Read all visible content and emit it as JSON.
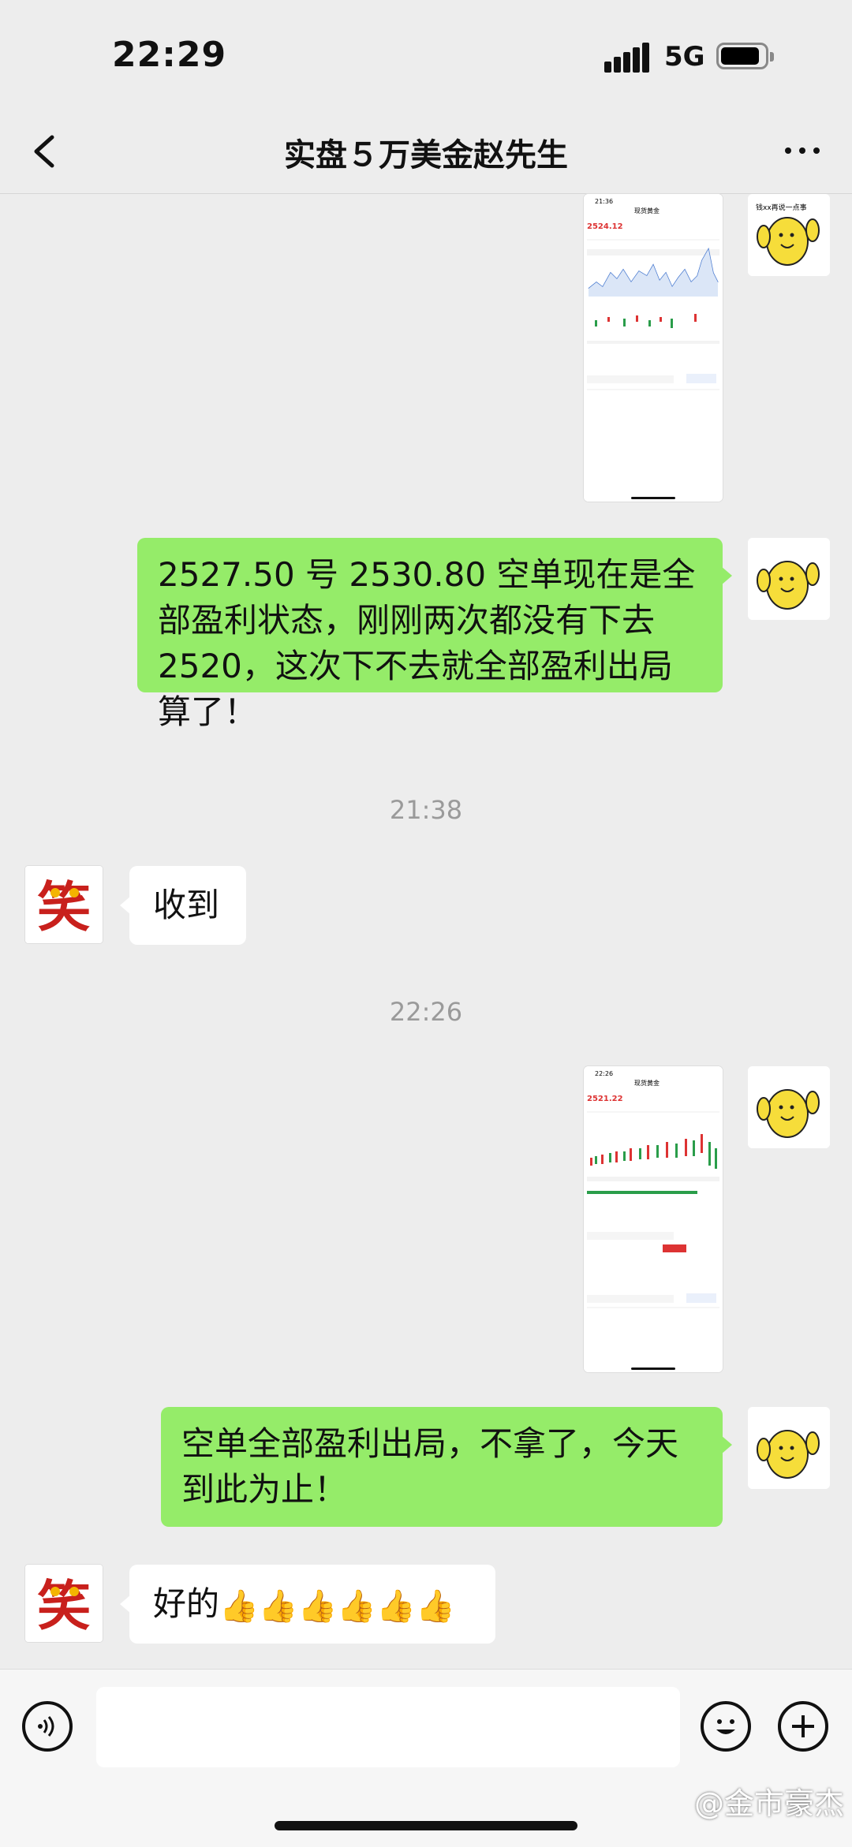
{
  "status_bar": {
    "time": "22:29",
    "network": "5G"
  },
  "header": {
    "title": "实盘５万美金赵先生"
  },
  "sticker_text": "钱xx再说一点事",
  "messages": {
    "screenshot1": {
      "time": "21:36",
      "app_title": "现货黄金",
      "price": "2524.12"
    },
    "msg1": {
      "text": "2527.50 号 2530.80 空单现在是全部盈利状态，刚刚两次都没有下去 2520，这次下不去就全部盈利出局算了！"
    },
    "ts1": "21:38",
    "msg2": {
      "text": "收到"
    },
    "ts2": "22:26",
    "screenshot2": {
      "time": "22:26",
      "app_title": "现货黄金",
      "price": "2521.22"
    },
    "msg3": {
      "text": "空单全部盈利出局，不拿了，今天到此为止！"
    },
    "msg4": {
      "text": "好的",
      "emoji": "👍👍👍👍👍👍"
    }
  },
  "contact_avatar_char": "笑",
  "watermark": "@金市豪杰",
  "colors": {
    "bubble_green": "#95ec69",
    "background": "#ededed"
  }
}
